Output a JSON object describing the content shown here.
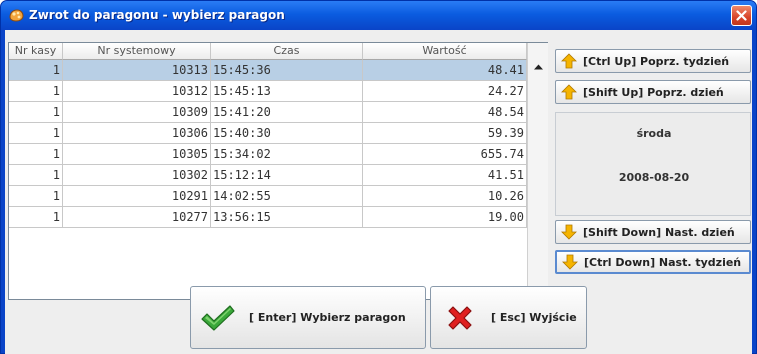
{
  "window": {
    "title": "Zwrot do paragonu - wybierz paragon"
  },
  "table": {
    "columns": [
      "Nr kasy",
      "Nr systemowy",
      "Czas",
      "Wartość"
    ],
    "rows": [
      {
        "kasa": "1",
        "system": "10313",
        "czas": "15:45:36",
        "wartosc": "48.41",
        "selected": true
      },
      {
        "kasa": "1",
        "system": "10312",
        "czas": "15:45:13",
        "wartosc": "24.27"
      },
      {
        "kasa": "1",
        "system": "10309",
        "czas": "15:41:20",
        "wartosc": "48.54"
      },
      {
        "kasa": "1",
        "system": "10306",
        "czas": "15:40:30",
        "wartosc": "59.39"
      },
      {
        "kasa": "1",
        "system": "10305",
        "czas": "15:34:02",
        "wartosc": "655.74"
      },
      {
        "kasa": "1",
        "system": "10302",
        "czas": "15:12:14",
        "wartosc": "41.51"
      },
      {
        "kasa": "1",
        "system": "10291",
        "czas": "14:02:55",
        "wartosc": "10.26"
      },
      {
        "kasa": "1",
        "system": "10277",
        "czas": "13:56:15",
        "wartosc": "19.00"
      }
    ]
  },
  "nav": {
    "prev_week": "[Ctrl Up] Poprz. tydzień",
    "prev_day": "[Shift Up] Poprz. dzień",
    "next_day": "[Shift Down] Nast. dzień",
    "next_week": "[Ctrl Down] Nast. tydzień"
  },
  "date_panel": {
    "day_name": "środa",
    "date": "2008-08-20"
  },
  "actions": {
    "select_label": "[ Enter] Wybierz paragon",
    "exit_label": "[ Esc] Wyjście"
  },
  "icons": {
    "title": "app-icon",
    "up": "arrow-up-icon",
    "down": "arrow-down-icon",
    "select": "checkmark-icon",
    "exit": "x-icon"
  },
  "colors": {
    "titlebar": "#0a5ce0",
    "selected_row": "#b8cfe5",
    "arrow": "#f5b400",
    "check": "#3aa83a",
    "cross": "#e02020"
  }
}
